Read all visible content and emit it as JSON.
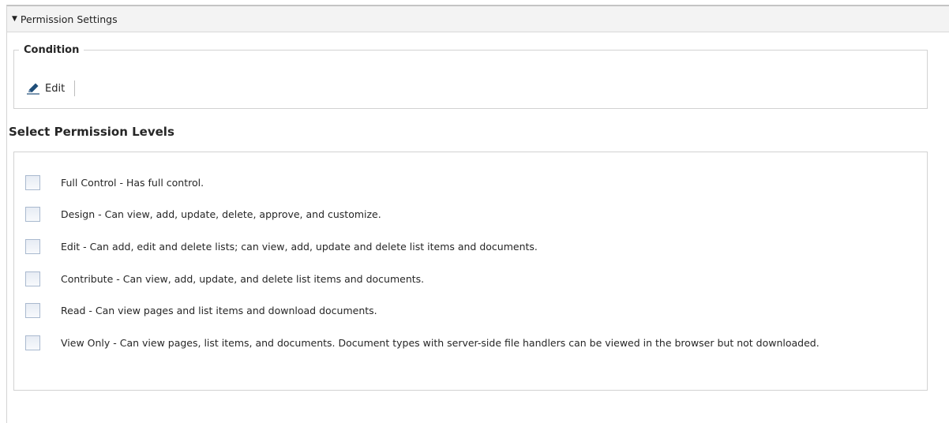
{
  "panel": {
    "title": "Permission Settings"
  },
  "condition": {
    "legend": "Condition",
    "edit_label": "Edit"
  },
  "permission_levels": {
    "heading": "Select Permission Levels",
    "items": [
      {
        "label": "Full Control - Has full control.",
        "checked": false
      },
      {
        "label": "Design - Can view, add, update, delete, approve, and customize.",
        "checked": false
      },
      {
        "label": "Edit - Can add, edit and delete lists; can view, add, update and delete list items and documents.",
        "checked": false
      },
      {
        "label": "Contribute - Can view, add, update, and delete list items and documents.",
        "checked": false
      },
      {
        "label": "Read - Can view pages and list items and download documents.",
        "checked": false
      },
      {
        "label": "View Only - Can view pages, list items, and documents. Document types with server-side file handlers can be viewed in the browser but not downloaded.",
        "checked": false
      }
    ]
  },
  "icons": {
    "caret": "caret-down-icon",
    "edit": "pencil-icon"
  }
}
